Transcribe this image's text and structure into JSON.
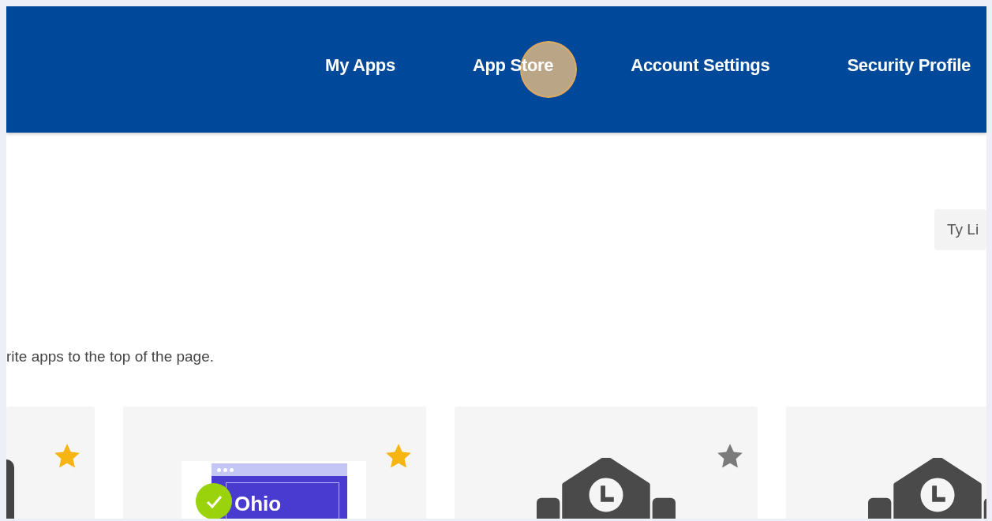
{
  "nav": [
    {
      "label": "My Apps",
      "clicked": false
    },
    {
      "label": "App Store",
      "clicked": true
    },
    {
      "label": "Account Settings",
      "clicked": false
    },
    {
      "label": "Security Profile",
      "clicked": false
    }
  ],
  "user_chip": {
    "text": "Ty Li"
  },
  "hint": "rite apps to the top of the page.",
  "apps": [
    {
      "kind": "partial",
      "favorite": true
    },
    {
      "kind": "logo",
      "favorite": true,
      "logo_text": "Ohio"
    },
    {
      "kind": "building",
      "favorite": false
    },
    {
      "kind": "building-cut"
    }
  ]
}
